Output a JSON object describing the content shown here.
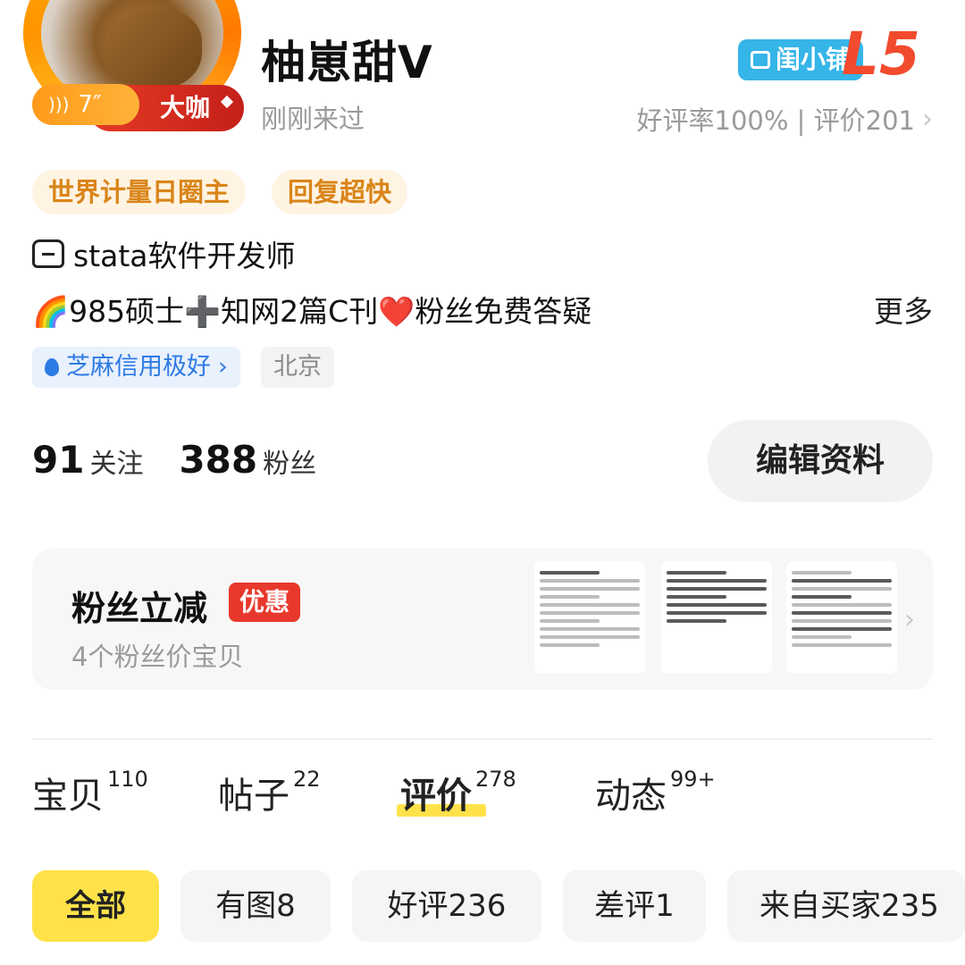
{
  "profile": {
    "nickname": "柚崽甜V",
    "last_seen": "刚刚来过",
    "voice_length": "7″",
    "rank_badge": "大咖",
    "shop_badge": "闺小铺",
    "level": "L5",
    "rating": "好评率100% | 评价201",
    "tags": [
      "世界计量日圈主",
      "回复超快"
    ],
    "job": "stata软件开发师",
    "bio": "🌈985硕士➕知网2篇C刊❤️粉丝免费答疑",
    "more": "更多",
    "credit": "芝麻信用极好",
    "city": "北京"
  },
  "stats": {
    "following_count": "91",
    "following_label": "关注",
    "fans_count": "388",
    "fans_label": "粉丝"
  },
  "edit_button": "编辑资料",
  "fan_promo": {
    "title": "粉丝立减",
    "badge": "优惠",
    "subtitle": "4个粉丝价宝贝"
  },
  "tabs": [
    {
      "label": "宝贝",
      "count": "110"
    },
    {
      "label": "帖子",
      "count": "22"
    },
    {
      "label": "评价",
      "count": "278"
    },
    {
      "label": "动态",
      "count": "99+"
    }
  ],
  "filters": [
    "全部",
    "有图8",
    "好评236",
    "差评1",
    "来自买家235"
  ],
  "colors": {
    "accent_yellow": "#ffe24a",
    "level_red": "#f24a2d",
    "shop_blue": "#35b5e8",
    "tag_orange": "#d98519",
    "credit_blue": "#2d7be5"
  },
  "icons": [
    "voice-wave-icon",
    "shop-icon",
    "store-icon",
    "flame-drop-icon",
    "chevron-right-icon"
  ]
}
